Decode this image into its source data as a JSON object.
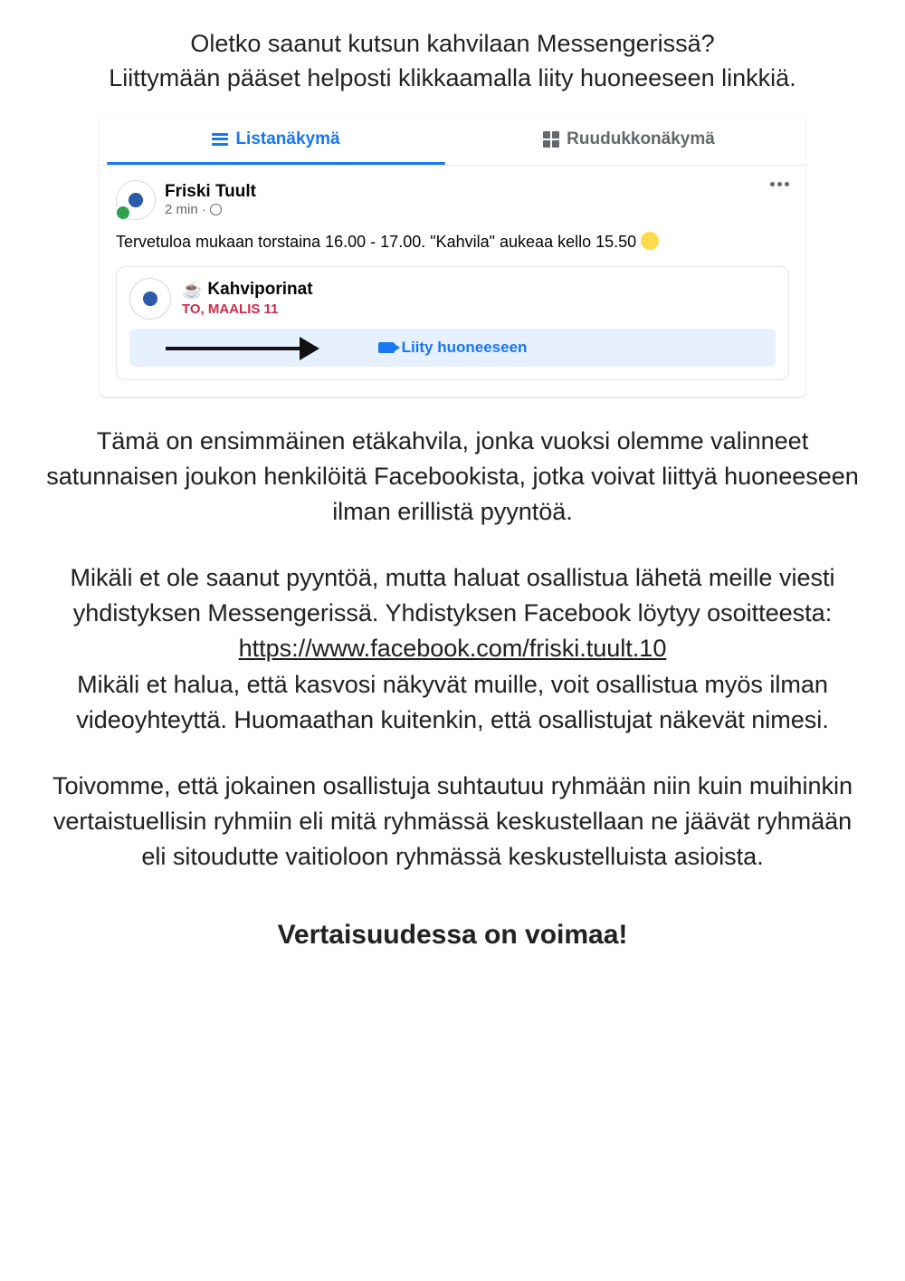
{
  "intro": {
    "line1": "Oletko saanut kutsun kahvilaan Messengerissä?",
    "line2": "Liittymään pääset helposti klikkaamalla liity huoneeseen linkkiä."
  },
  "screenshot": {
    "tabs": {
      "list": "Listanäkymä",
      "grid": "Ruudukkonäkymä"
    },
    "post": {
      "author": "Friski Tuult",
      "time": "2 min",
      "text": "Tervetuloa mukaan torstaina 16.00 - 17.00. \"Kahvila\" aukeaa kello 15.50 "
    },
    "event": {
      "title": "Kahviporinat",
      "date": "TO, MAALIS 11",
      "join_label": "Liity huoneeseen"
    }
  },
  "body": {
    "p1": "Tämä on ensimmäinen etäkahvila, jonka vuoksi olemme valinneet satunnaisen joukon henkilöitä Facebookista, jotka voivat liittyä huoneeseen ilman erillistä pyyntöä.",
    "p2a": "Mikäli et ole saanut pyyntöä, mutta haluat osallistua lähetä meille viesti yhdistyksen Messengerissä. Yhdistyksen Facebook löytyy osoitteesta: ",
    "p2link": "https://www.facebook.com/friski.tuult.10",
    "p2b": "Mikäli et halua, että kasvosi näkyvät muille, voit osallistua myös ilman videoyhteyttä. Huomaathan kuitenkin, että osallistujat näkevät nimesi.",
    "p3": "Toivomme, että jokainen osallistuja suhtautuu ryhmään niin kuin muihinkin vertaistuellisin ryhmiin eli mitä ryhmässä keskustellaan ne jäävät ryhmään eli sitoudutte vaitioloon ryhmässä keskustelluista asioista."
  },
  "closing": "Vertaisuudessa on voimaa!"
}
